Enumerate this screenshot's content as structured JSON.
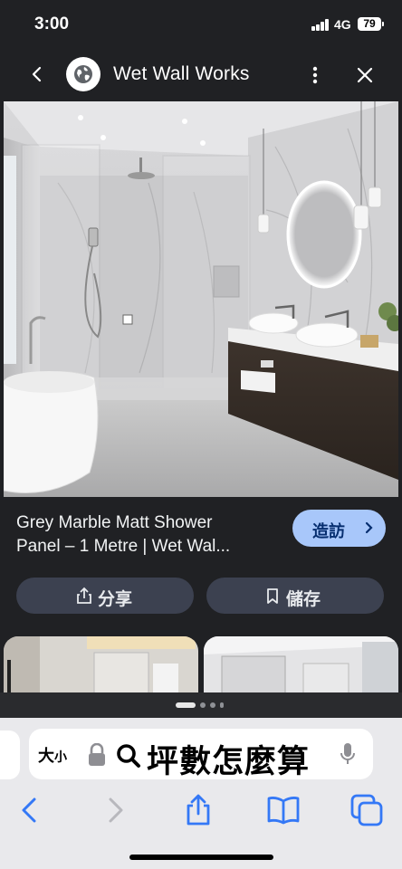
{
  "status_bar": {
    "time": "3:00",
    "network": "4G",
    "battery": "79"
  },
  "header": {
    "site_name": "Wet Wall Works"
  },
  "result": {
    "title_line1": "Grey Marble Matt Shower",
    "title_line2": "Panel – 1 Metre | Wet Wal...",
    "visit_label": "造訪"
  },
  "actions": {
    "share_label": "分享",
    "save_label": "儲存"
  },
  "pager": {
    "count": 4,
    "active": 0
  },
  "address_bar": {
    "text_size_large": "大",
    "text_size_small": "小",
    "query": "坪數怎麼算"
  },
  "colors": {
    "background": "#202124",
    "accent": "#a8c7fa",
    "toolbar_blue": "#3478f6"
  },
  "icons": [
    "back-chevron-icon",
    "globe-icon",
    "more-vertical-icon",
    "close-icon",
    "share-icon",
    "bookmark-icon",
    "lock-icon",
    "search-icon",
    "mic-icon",
    "safari-back-icon",
    "safari-forward-icon",
    "safari-share-icon",
    "bookmarks-icon",
    "tabs-icon"
  ]
}
